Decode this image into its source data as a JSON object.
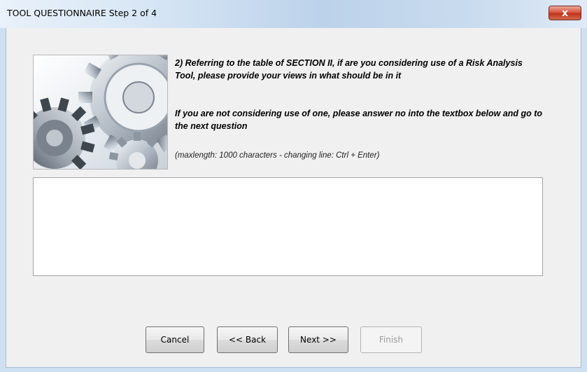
{
  "window": {
    "title": "TOOL QUESTIONNAIRE Step 2 of 4",
    "close_glyph": "x"
  },
  "question": {
    "line1": "2) Referring to the table of SECTION II, if are you considering use of a Risk Analysis Tool, please provide your views in what should be in it",
    "line2": "If you are not considering use of one, please answer no into the textbox below and go to the next question",
    "hint": "(maxlength: 1000 characters - changing line: Ctrl + Enter)"
  },
  "answer": {
    "value": ""
  },
  "buttons": {
    "cancel": "Cancel",
    "back": "<< Back",
    "next": "Next >>",
    "finish": "Finish"
  },
  "image": {
    "icon": "gears-icon"
  }
}
